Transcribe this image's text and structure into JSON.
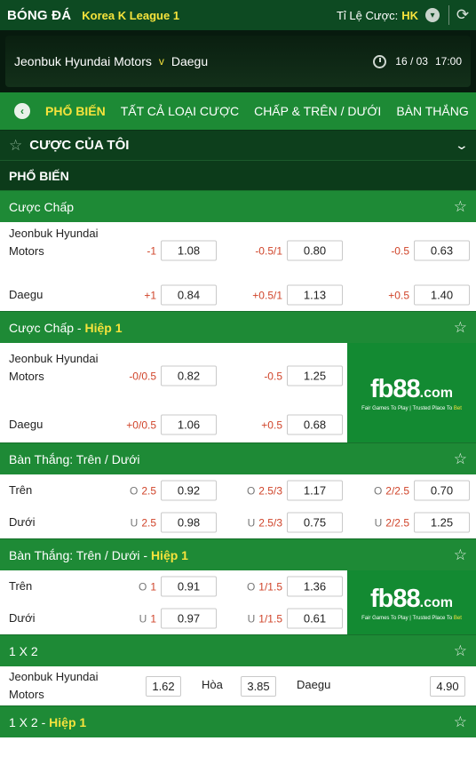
{
  "header": {
    "sport": "BÓNG ĐÁ",
    "league": "Korea K League 1",
    "odds_label": "Tỉ Lệ Cược:",
    "odds_format": "HK",
    "dropdown_icon": "chevron-down-icon",
    "refresh_icon": "refresh-icon"
  },
  "match": {
    "home": "Jeonbuk Hyundai Motors",
    "vs": "v",
    "away": "Daegu",
    "date": "16 / 03",
    "time": "17:00"
  },
  "tabs": [
    {
      "label": "PHỔ BIẾN",
      "active": true
    },
    {
      "label": "TẤT CẢ LOẠI CƯỢC",
      "active": false
    },
    {
      "label": "CHẤP & TRÊN / DƯỚI",
      "active": false
    },
    {
      "label": "BÀN THẮNG",
      "active": false
    }
  ],
  "my_bets": {
    "label": "CƯỢC CỦA TÔI"
  },
  "popular_label": "PHỔ BIẾN",
  "markets": {
    "handicap": {
      "title": "Cược Chấp",
      "rows": [
        {
          "team": "Jeonbuk Hyundai Motors",
          "cells": [
            [
              "-1",
              "1.08"
            ],
            [
              "-0.5/1",
              "0.80"
            ],
            [
              "-0.5",
              "0.63"
            ]
          ]
        },
        {
          "team": "Daegu",
          "cells": [
            [
              "+1",
              "0.84"
            ],
            [
              "+0.5/1",
              "1.13"
            ],
            [
              "+0.5",
              "1.40"
            ]
          ]
        }
      ]
    },
    "handicap_h1": {
      "title": "Cược Chấp",
      "dash": " - ",
      "period": "Hiệp 1",
      "rows": [
        {
          "team": "Jeonbuk Hyundai Motors",
          "cells": [
            [
              "-0/0.5",
              "0.82"
            ],
            [
              "-0.5",
              "1.25"
            ]
          ]
        },
        {
          "team": "Daegu",
          "cells": [
            [
              "+0/0.5",
              "1.06"
            ],
            [
              "+0.5",
              "0.68"
            ]
          ]
        }
      ]
    },
    "ou": {
      "title": "Bàn Thắng: Trên / Dưới",
      "rows": [
        {
          "team": "Trên",
          "cells": [
            [
              "O",
              "2.5",
              "0.92"
            ],
            [
              "O",
              "2.5/3",
              "1.17"
            ],
            [
              "O",
              "2/2.5",
              "0.70"
            ]
          ]
        },
        {
          "team": "Dưới",
          "cells": [
            [
              "U",
              "2.5",
              "0.98"
            ],
            [
              "U",
              "2.5/3",
              "0.75"
            ],
            [
              "U",
              "2/2.5",
              "1.25"
            ]
          ]
        }
      ]
    },
    "ou_h1": {
      "title": "Bàn Thắng: Trên / Dưới",
      "dash": " - ",
      "period": "Hiệp 1",
      "rows": [
        {
          "team": "Trên",
          "cells": [
            [
              "O",
              "1",
              "0.91"
            ],
            [
              "O",
              "1/1.5",
              "1.36"
            ]
          ]
        },
        {
          "team": "Dưới",
          "cells": [
            [
              "U",
              "1",
              "0.97"
            ],
            [
              "U",
              "1/1.5",
              "0.61"
            ]
          ]
        }
      ]
    },
    "x12": {
      "title": "1 X 2",
      "home": "Jeonbuk Hyundai Motors",
      "home_odd": "1.62",
      "draw": "Hòa",
      "draw_odd": "3.85",
      "away": "Daegu",
      "away_odd": "4.90"
    },
    "x12_h1": {
      "title": "1 X 2",
      "dash": " - ",
      "period": "Hiệp 1"
    }
  },
  "ad": {
    "brand": "fb88",
    "domain": ".com",
    "tag_left": "Fair Games To Play",
    "tag_right_a": "Trusted Place To ",
    "tag_right_b": "Bet"
  },
  "colors": {
    "dark_green": "#0d4a22",
    "green": "#1e8a36",
    "yellow": "#f6e33c",
    "red_label": "#d0442a"
  }
}
